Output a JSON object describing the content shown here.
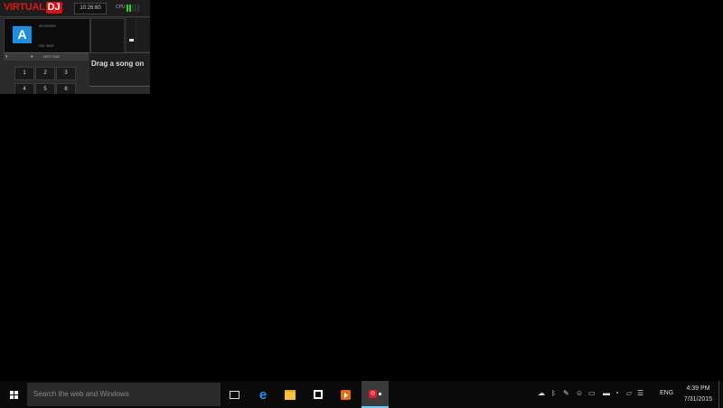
{
  "vdj": {
    "logo_text": "VIRTUAL",
    "logo_dj": "DJ",
    "clock": "10:26:60",
    "cpu_label": "CPU",
    "deck_letter": "A",
    "deck_line1": "50 MISSM",
    "deck_line2": "SEL BAR",
    "hotcue_label": "HOT CUE",
    "pads": [
      "1",
      "2",
      "3",
      "4",
      "5",
      "6"
    ],
    "browser_hint": "Drag a song on"
  },
  "taskbar": {
    "search_placeholder": "Search the web and Windows",
    "language": "ENG",
    "time": "4:39 PM",
    "date": "7/31/2015"
  },
  "colors": {
    "deck_blue": "#1e8ee0",
    "vdj_red": "#e01818",
    "cpu_green": "#2bd12b"
  }
}
